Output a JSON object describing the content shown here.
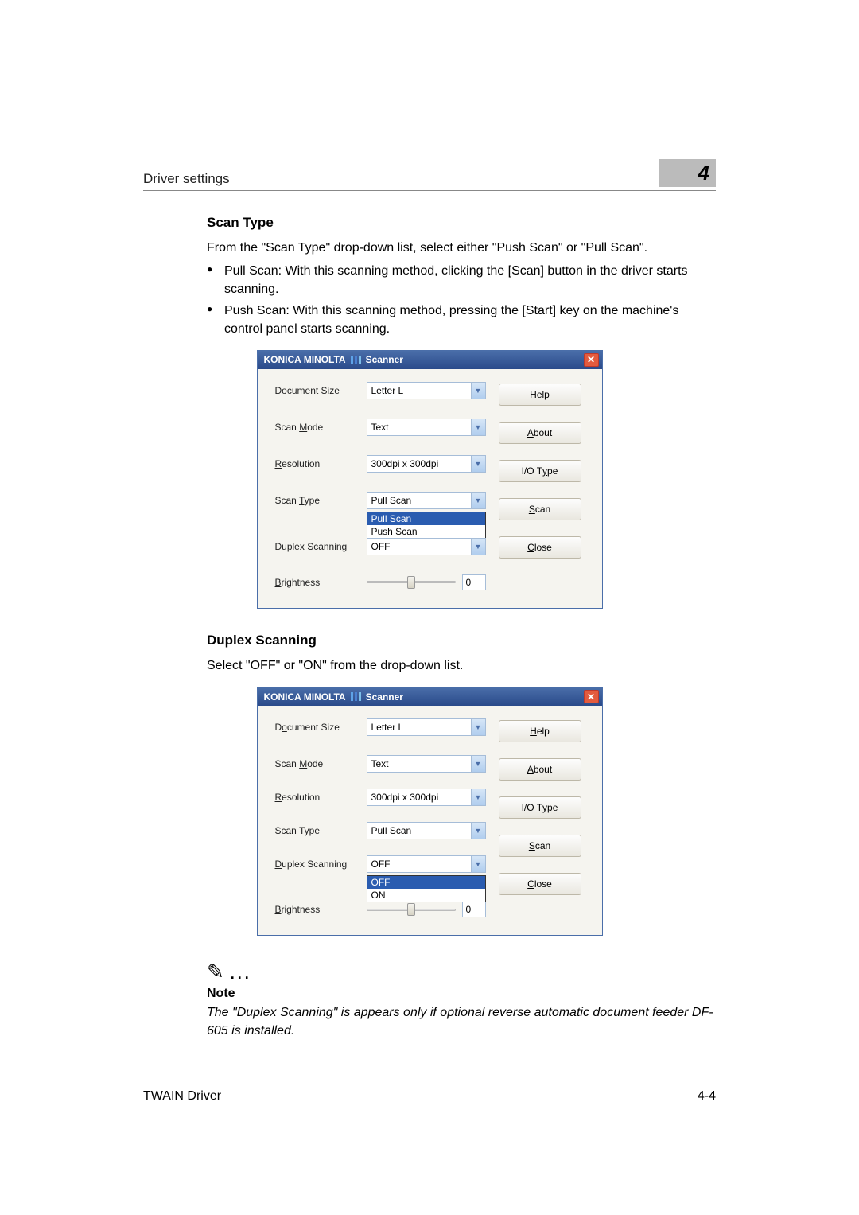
{
  "header": {
    "left": "Driver settings",
    "chapter": "4"
  },
  "section1": {
    "heading": "Scan Type",
    "para": "From the \"Scan Type\" drop-down list, select either \"Push Scan\" or \"Pull Scan\".",
    "bullets": [
      "Pull Scan: With this scanning method, clicking the [Scan] button in the driver starts scanning.",
      "Push Scan: With this scanning method, pressing the [Start] key on the machine's control panel starts scanning."
    ]
  },
  "dialog1": {
    "brand": "KONICA MINOLTA",
    "title_suffix": "Scanner",
    "labels": {
      "document_size_pre": "D",
      "document_size_u": "o",
      "document_size_post": "cument Size",
      "scan_mode_pre": "Scan ",
      "scan_mode_u": "M",
      "scan_mode_post": "ode",
      "resolution_u": "R",
      "resolution_post": "esolution",
      "scan_type_pre": "Scan ",
      "scan_type_u": "T",
      "scan_type_post": "ype",
      "duplex_u": "D",
      "duplex_post": "uplex Scanning",
      "brightness_u": "B",
      "brightness_post": "rightness"
    },
    "values": {
      "document_size": "Letter L",
      "scan_mode": "Text",
      "resolution": "300dpi x 300dpi",
      "scan_type": "Pull Scan",
      "scan_type_options": [
        "Pull Scan",
        "Push Scan"
      ],
      "duplex": "OFF",
      "brightness": "0"
    },
    "buttons": {
      "help_u": "H",
      "help_post": "elp",
      "about_u": "A",
      "about_post": "bout",
      "iotype_pre": "I/O T",
      "iotype_u": "y",
      "iotype_post": "pe",
      "scan_u": "S",
      "scan_post": "can",
      "close_u": "C",
      "close_post": "lose"
    }
  },
  "section2": {
    "heading": "Duplex Scanning",
    "para": "Select \"OFF\" or \"ON\" from the drop-down list."
  },
  "dialog2": {
    "values": {
      "scan_type": "Pull Scan",
      "duplex": "OFF",
      "duplex_options": [
        "OFF",
        "ON"
      ]
    }
  },
  "note": {
    "heading": "Note",
    "body": "The \"Duplex Scanning\" is appears only if optional reverse automatic document feeder DF-605 is installed."
  },
  "footer": {
    "left": "TWAIN Driver",
    "right": "4-4"
  }
}
